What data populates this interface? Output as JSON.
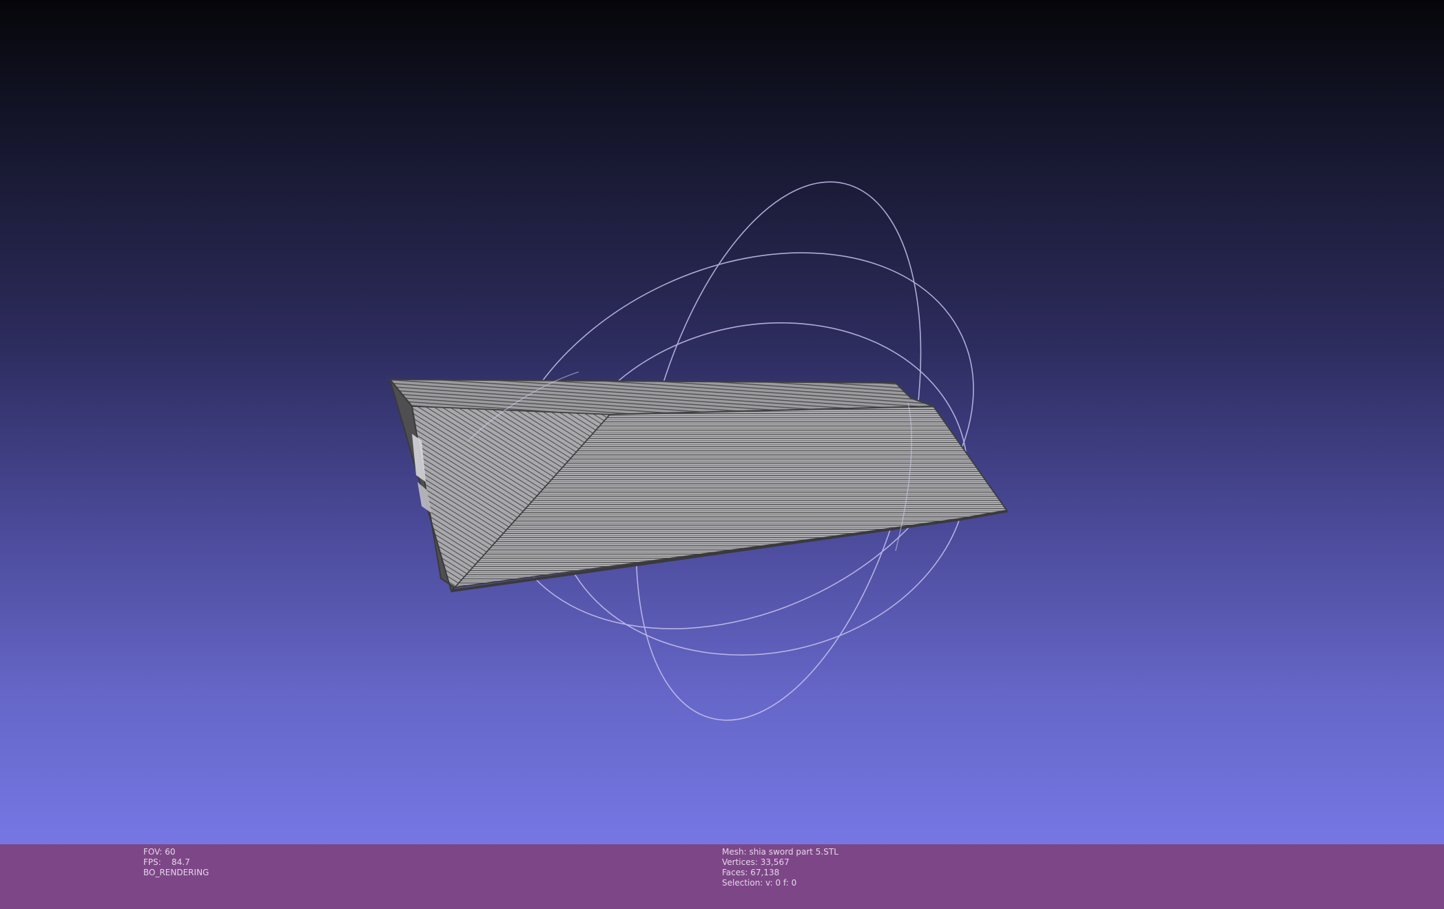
{
  "viewport": {
    "background_top": "#06060a",
    "background_bottom": "#7677e4",
    "mesh_fill": "#b0b0b4",
    "mesh_dark": "#4c4c4e",
    "trackball_color": "#c8c4ee"
  },
  "info": {
    "left": {
      "fov": "FOV: 60",
      "fps": "FPS:    84.7",
      "mode": "BO_RENDERING"
    },
    "right": {
      "mesh": "Mesh: shia sword part 5.STL",
      "vertices": "Vertices: 33,567",
      "faces": "Faces: 67,138",
      "selection": "Selection: v: 0 f: 0"
    },
    "bar_color": "#7d4787"
  }
}
